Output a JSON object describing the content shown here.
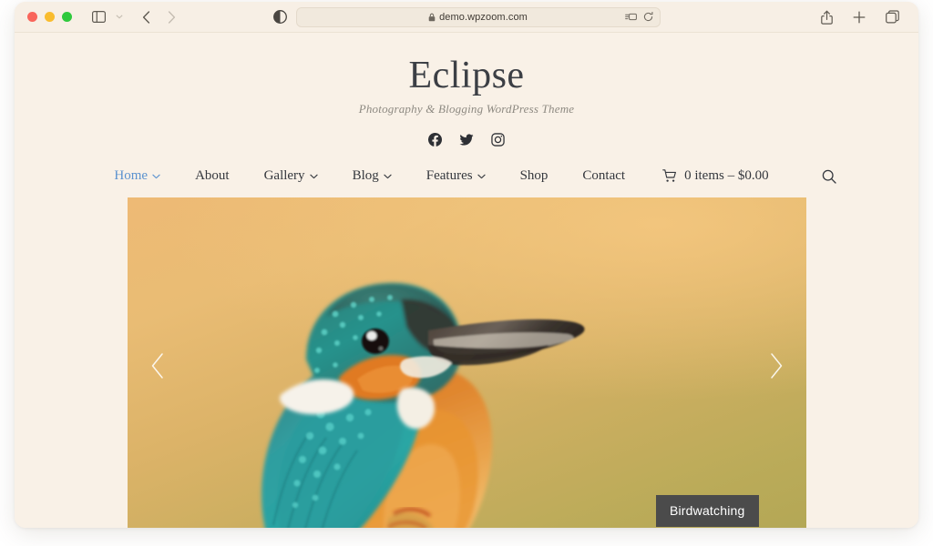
{
  "browser": {
    "traffic_lights": [
      "close",
      "minimize",
      "zoom"
    ],
    "sidebar_toggle": "sidebar-icon",
    "back_label": "Back",
    "forward_label": "Forward",
    "reader_label": "Reader view",
    "url": "demo.wpzoom.com",
    "lock": "lock-icon",
    "extensions_label": "Extensions",
    "reload_label": "Reload",
    "share_label": "Share",
    "new_tab_label": "New Tab",
    "tab_overview_label": "Tab Overview"
  },
  "site": {
    "title": "Eclipse",
    "tagline": "Photography & Blogging WordPress Theme",
    "social": [
      {
        "name": "facebook",
        "label": "Facebook"
      },
      {
        "name": "twitter",
        "label": "Twitter"
      },
      {
        "name": "instagram",
        "label": "Instagram"
      }
    ]
  },
  "nav": {
    "items": [
      {
        "label": "Home",
        "has_dropdown": true,
        "active": true
      },
      {
        "label": "About",
        "has_dropdown": false,
        "active": false
      },
      {
        "label": "Gallery",
        "has_dropdown": true,
        "active": false
      },
      {
        "label": "Blog",
        "has_dropdown": true,
        "active": false
      },
      {
        "label": "Features",
        "has_dropdown": true,
        "active": false
      },
      {
        "label": "Shop",
        "has_dropdown": false,
        "active": false
      },
      {
        "label": "Contact",
        "has_dropdown": false,
        "active": false
      }
    ],
    "cart": {
      "icon": "cart-icon",
      "label": "0 items – $0.00",
      "count": 0,
      "total": "$0.00"
    },
    "search_label": "Search"
  },
  "hero": {
    "caption": "Birdwatching",
    "prev_label": "Previous slide",
    "next_label": "Next slide",
    "image_subject": "kingfisher bird perched, golden bokeh background"
  },
  "colors": {
    "page_background": "#f9f1e7",
    "heading": "#3c3f45",
    "tagline": "#8e8a82",
    "nav_text": "#34373d",
    "nav_active": "#5b92cf",
    "caption_background": "#4b4b4b",
    "caption_text": "#ffffff",
    "hero_top": "#eeba75",
    "hero_bottom": "#b3a755"
  }
}
